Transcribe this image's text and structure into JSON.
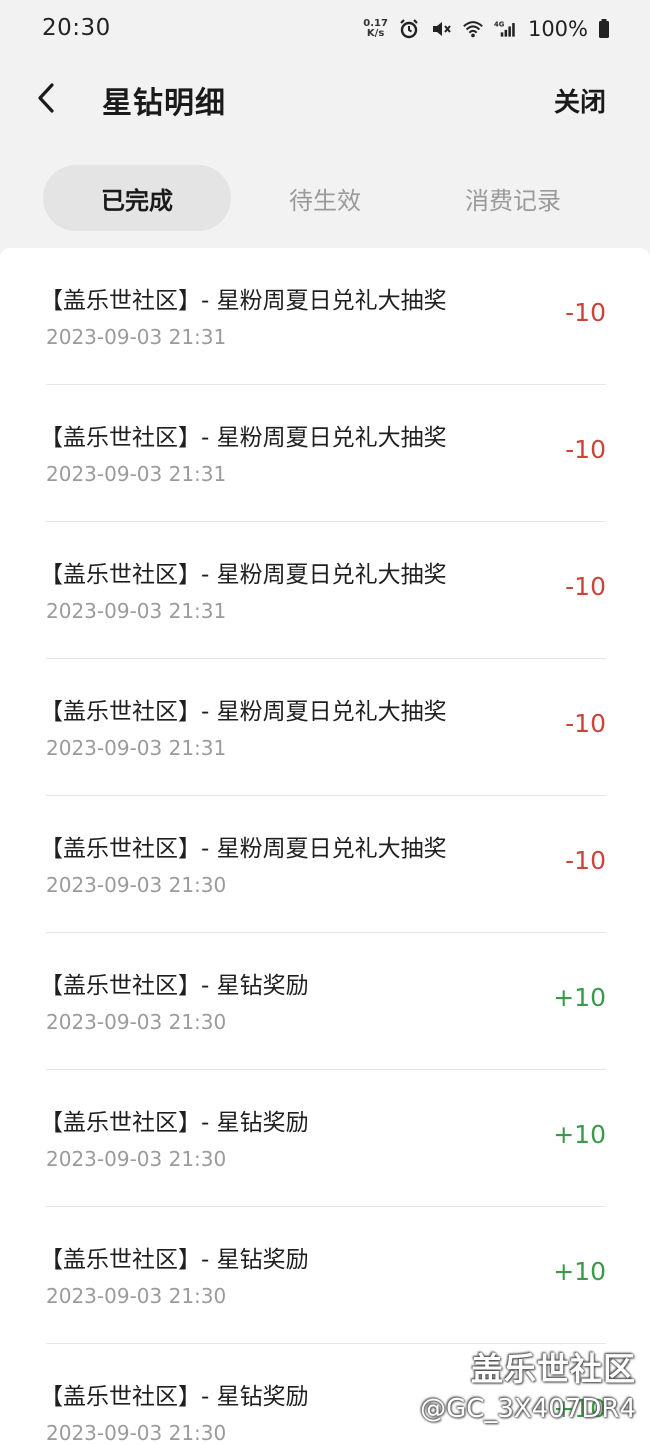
{
  "status_bar": {
    "time": "20:30",
    "net_speed_value": "0.17",
    "net_speed_unit": "K/s",
    "battery": "100%",
    "icons": [
      "alarm-icon",
      "mute-icon",
      "wifi-icon",
      "signal-4g-icon",
      "battery-icon"
    ]
  },
  "header": {
    "title": "星钻明细",
    "close_label": "关闭"
  },
  "tabs": [
    {
      "label": "已完成",
      "active": true
    },
    {
      "label": "待生效",
      "active": false
    },
    {
      "label": "消费记录",
      "active": false
    }
  ],
  "records": [
    {
      "title": "【盖乐世社区】- 星粉周夏日兑礼大抽奖",
      "time": "2023-09-03 21:31",
      "amount": "-10",
      "sign": "neg"
    },
    {
      "title": "【盖乐世社区】- 星粉周夏日兑礼大抽奖",
      "time": "2023-09-03 21:31",
      "amount": "-10",
      "sign": "neg"
    },
    {
      "title": "【盖乐世社区】- 星粉周夏日兑礼大抽奖",
      "time": "2023-09-03 21:31",
      "amount": "-10",
      "sign": "neg"
    },
    {
      "title": "【盖乐世社区】- 星粉周夏日兑礼大抽奖",
      "time": "2023-09-03 21:31",
      "amount": "-10",
      "sign": "neg"
    },
    {
      "title": "【盖乐世社区】- 星粉周夏日兑礼大抽奖",
      "time": "2023-09-03 21:30",
      "amount": "-10",
      "sign": "neg"
    },
    {
      "title": "【盖乐世社区】- 星钻奖励",
      "time": "2023-09-03 21:30",
      "amount": "+10",
      "sign": "pos"
    },
    {
      "title": "【盖乐世社区】- 星钻奖励",
      "time": "2023-09-03 21:30",
      "amount": "+10",
      "sign": "pos"
    },
    {
      "title": "【盖乐世社区】- 星钻奖励",
      "time": "2023-09-03 21:30",
      "amount": "+10",
      "sign": "pos"
    },
    {
      "title": "【盖乐世社区】- 星钻奖励",
      "time": "2023-09-03 21:30",
      "amount": "+10",
      "sign": "pos"
    }
  ],
  "watermark": {
    "line1": "盖乐世社区",
    "line2": "@GC_3X407DR4"
  },
  "colors": {
    "negative": "#c9453a",
    "positive": "#3a9a4a",
    "background": "#f2f2f2",
    "tab_active_bg": "#e4e4e4"
  }
}
